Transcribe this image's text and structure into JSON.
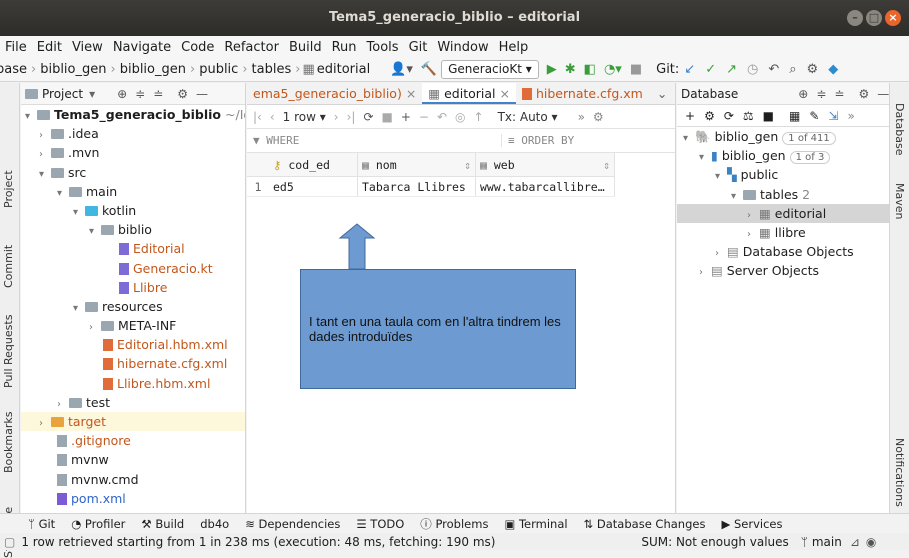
{
  "window": {
    "title": "Tema5_generacio_biblio – editorial"
  },
  "menu": [
    "File",
    "Edit",
    "View",
    "Navigate",
    "Code",
    "Refactor",
    "Build",
    "Run",
    "Tools",
    "Git",
    "Window",
    "Help"
  ],
  "breadcrumb": [
    "base",
    "biblio_gen",
    "biblio_gen",
    "public",
    "tables",
    "editorial"
  ],
  "toolbar": {
    "run_config": "GeneracioKt",
    "git_label": "Git:"
  },
  "project_panel": {
    "title": "Project",
    "root": "Tema5_generacio_biblio",
    "root_path": "~/Ide",
    "items": [
      ".idea",
      ".mvn",
      "src",
      "main",
      "kotlin",
      "biblio",
      "Editorial",
      "Generacio.kt",
      "Llibre",
      "resources",
      "META-INF",
      "Editorial.hbm.xml",
      "hibernate.cfg.xml",
      "Llibre.hbm.xml",
      "test",
      "target",
      ".gitignore",
      "mvnw",
      "mvnw.cmd",
      "pom.xml"
    ]
  },
  "editor_tabs": [
    "ema5_generacio_biblio)",
    "editorial",
    "hibernate.cfg.xm"
  ],
  "grid_toolbar": {
    "rows": "1 row",
    "tx": "Tx: Auto"
  },
  "filter": {
    "where": "WHERE",
    "order_by": "ORDER BY"
  },
  "table": {
    "columns": [
      "cod_ed",
      "nom",
      "web"
    ],
    "rows": [
      {
        "num": "1",
        "cells": [
          "ed5",
          "Tabarca Llibres",
          "www.tabarcallibre…"
        ]
      }
    ]
  },
  "database_panel": {
    "title": "Database",
    "items": [
      {
        "label": "biblio_gen",
        "badge": "1 of 411"
      },
      {
        "label": "biblio_gen",
        "badge": "1 of 3"
      },
      {
        "label": "public",
        "badge": ""
      },
      {
        "label": "tables",
        "badge": "2"
      },
      {
        "label": "editorial",
        "badge": ""
      },
      {
        "label": "llibre",
        "badge": ""
      },
      {
        "label": "Database Objects",
        "badge": ""
      },
      {
        "label": "Server Objects",
        "badge": ""
      }
    ]
  },
  "callout": {
    "text": "I tant en una taula com en l'altra tindrem les dades introduïdes"
  },
  "left_tabs": [
    "Project",
    "Commit",
    "Pull Requests",
    "Bookmarks",
    "Structure"
  ],
  "right_tabs": [
    "Database",
    "Maven",
    "Notifications"
  ],
  "bottom_tools": [
    "Git",
    "Profiler",
    "Build",
    "db4o",
    "Dependencies",
    "TODO",
    "Problems",
    "Terminal",
    "Database Changes",
    "Services"
  ],
  "status": {
    "message": "1 row retrieved starting from 1 in 238 ms (execution: 48 ms, fetching: 190 ms)",
    "sum": "SUM: Not enough values",
    "branch": "main"
  }
}
